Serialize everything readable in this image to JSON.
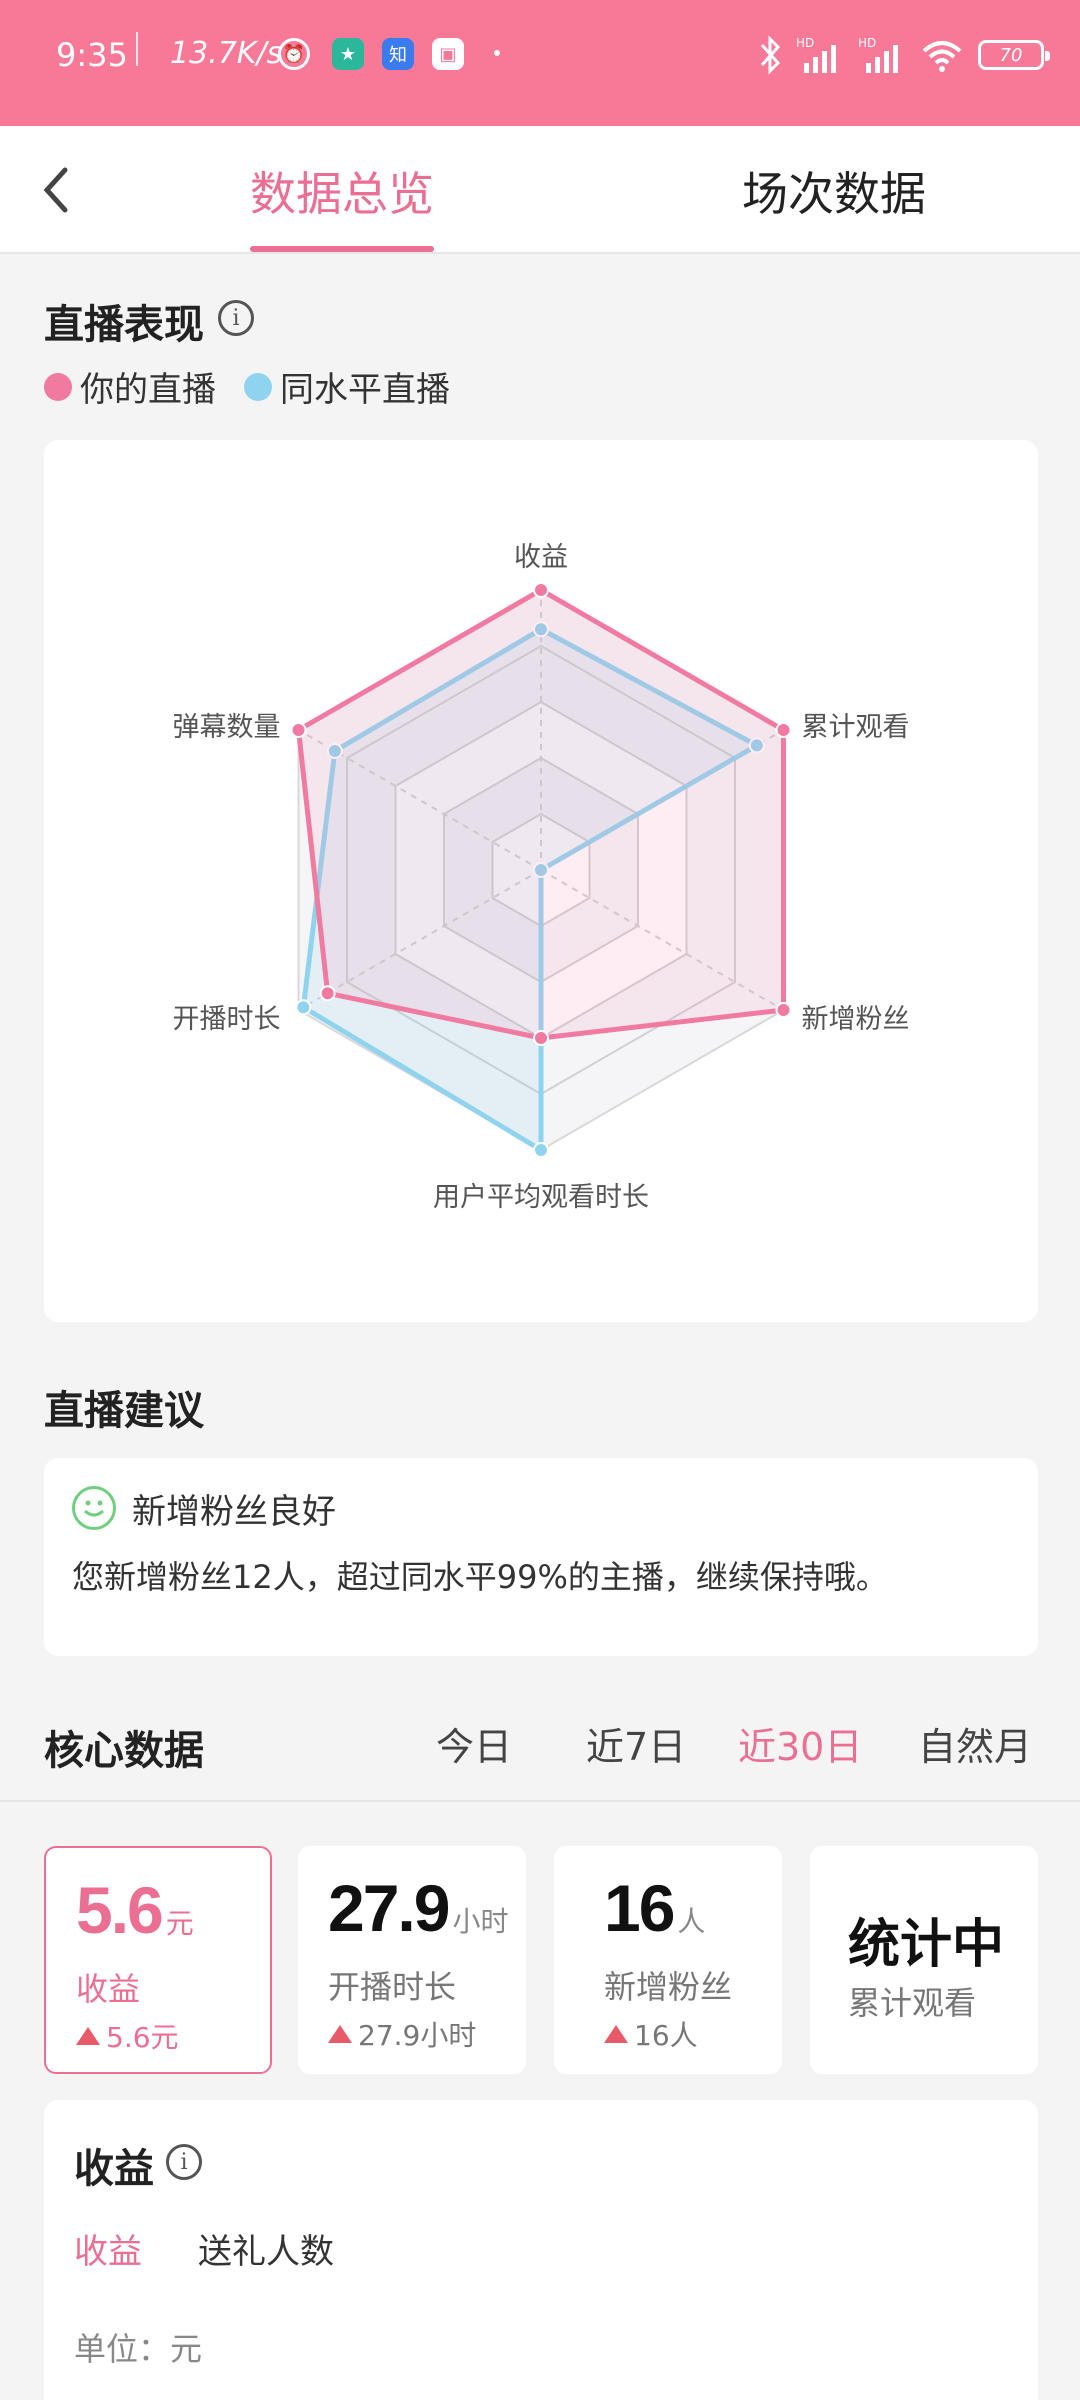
{
  "status_bar": {
    "time": "9:35",
    "speed": "13.7K/s",
    "battery": "70"
  },
  "tabs": [
    "数据总览",
    "场次数据"
  ],
  "performance": {
    "title": "直播表现",
    "legend": [
      {
        "label": "你的直播",
        "color": "#f07aa0"
      },
      {
        "label": "同水平直播",
        "color": "#8fd3ef"
      }
    ]
  },
  "chart_data": {
    "type": "radar",
    "axes": [
      "收益",
      "累计观看",
      "新增粉丝",
      "用户平均观看时长",
      "开播时长",
      "弹幕数量"
    ],
    "series": [
      {
        "name": "你的直播",
        "color": "#f07aa0",
        "values": [
          1.0,
          1.0,
          1.0,
          0.6,
          0.88,
          1.0
        ]
      },
      {
        "name": "同水平直播",
        "color": "#8fd3ef",
        "values": [
          0.86,
          0.89,
          0.0,
          1.0,
          0.98,
          0.85
        ]
      }
    ],
    "rings": 5,
    "range": [
      0,
      1
    ]
  },
  "suggestion": {
    "section_title": "直播建议",
    "title": "新增粉丝良好",
    "text": "您新增粉丝12人，超过同水平99%的主播，继续保持哦。"
  },
  "core": {
    "title": "核心数据",
    "periods": [
      "今日",
      "近7日",
      "近30日",
      "自然月"
    ],
    "active_period": "近30日",
    "metrics": [
      {
        "value": "5.6",
        "unit": "元",
        "label": "收益",
        "delta": "5.6元",
        "selected": true
      },
      {
        "value": "27.9",
        "unit": "小时",
        "label": "开播时长",
        "delta": "27.9小时"
      },
      {
        "value": "16",
        "unit": "人",
        "label": "新增粉丝",
        "delta": "16人"
      },
      {
        "value": "统计中",
        "label": "累计观看"
      }
    ]
  },
  "income": {
    "title": "收益",
    "tabs": [
      "收益",
      "送礼人数"
    ],
    "unit_label": "单位：元"
  }
}
